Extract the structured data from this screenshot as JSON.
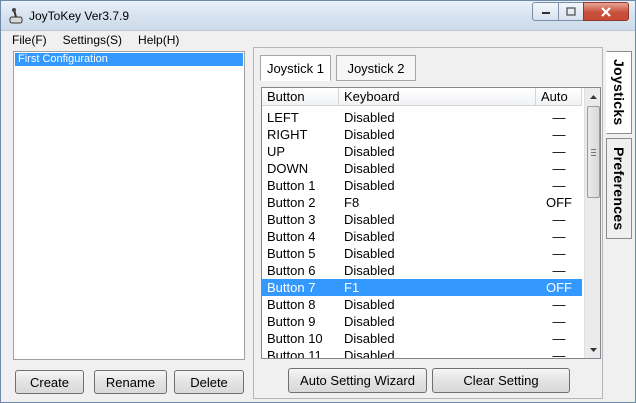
{
  "window": {
    "title": "JoyToKey Ver3.7.9"
  },
  "menu": [
    "File(F)",
    "Settings(S)",
    "Help(H)"
  ],
  "configs": {
    "items": [
      "First Configuration"
    ]
  },
  "left_buttons": {
    "create": "Create",
    "rename": "Rename",
    "delete": "Delete"
  },
  "subtabs": [
    "Joystick 1",
    "Joystick 2"
  ],
  "grid": {
    "headers": [
      "Button",
      "Keyboard",
      "Auto"
    ],
    "selected_row": 11,
    "rows": [
      [
        "LEFT",
        "Disabled",
        "—"
      ],
      [
        "RIGHT",
        "Disabled",
        "—"
      ],
      [
        "UP",
        "Disabled",
        "—"
      ],
      [
        "DOWN",
        "Disabled",
        "—"
      ],
      [
        "Button 1",
        "Disabled",
        "—"
      ],
      [
        "Button 2",
        "F8",
        "OFF"
      ],
      [
        "Button 3",
        "Disabled",
        "—"
      ],
      [
        "Button 4",
        "Disabled",
        "—"
      ],
      [
        "Button 5",
        "Disabled",
        "—"
      ],
      [
        "Button 6",
        "Disabled",
        "—"
      ],
      [
        "Button 7",
        "F1",
        "OFF"
      ],
      [
        "Button 8",
        "Disabled",
        "—"
      ],
      [
        "Button 9",
        "Disabled",
        "—"
      ],
      [
        "Button 10",
        "Disabled",
        "—"
      ],
      [
        "Button 11",
        "Disabled",
        "—"
      ]
    ]
  },
  "right_buttons": {
    "wizard": "Auto Setting Wizard",
    "clear": "Clear Setting"
  },
  "side_tabs": {
    "joysticks": "Joysticks",
    "preferences": "Preferences"
  },
  "colors": {
    "selection": "#3399ff",
    "close_button": "#c94a33"
  }
}
